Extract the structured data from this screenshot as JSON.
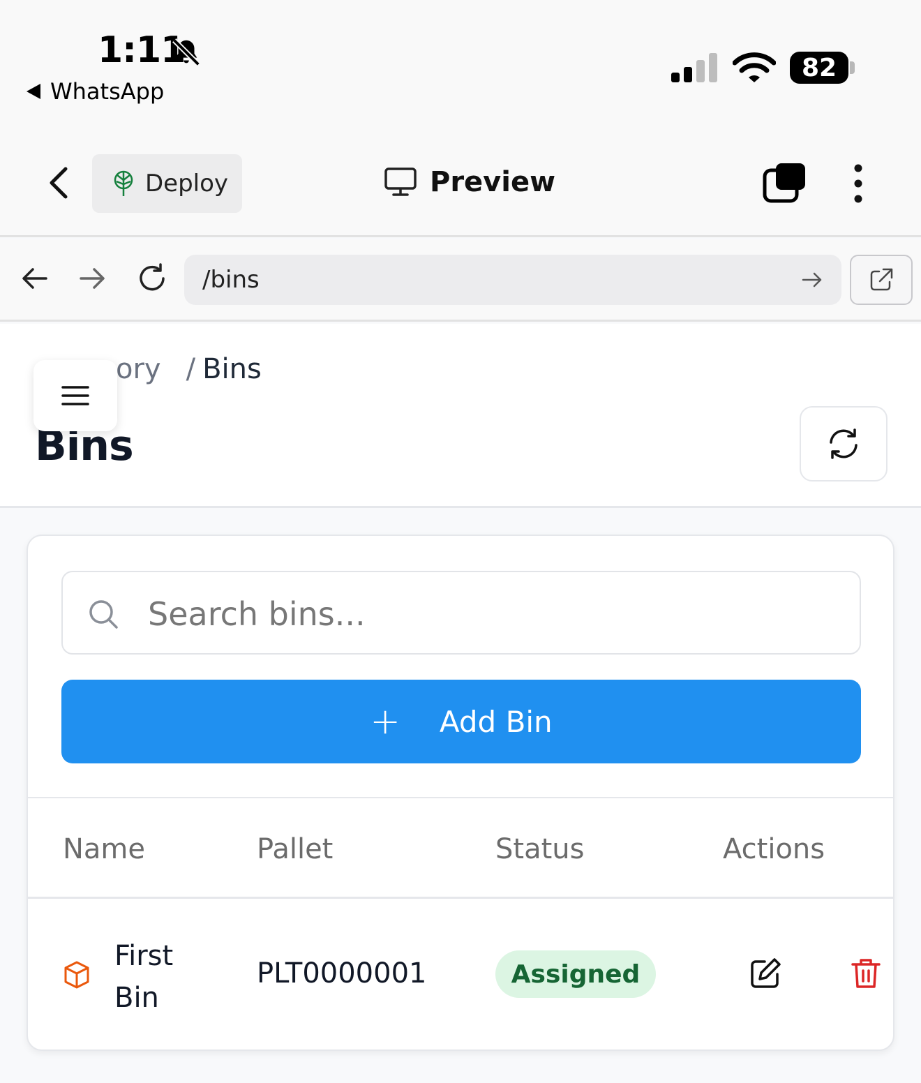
{
  "status_bar": {
    "time": "1:11",
    "back_app": "WhatsApp",
    "battery": "82",
    "icons": [
      "bell-slash-icon",
      "cellular-signal-icon",
      "wifi-icon",
      "battery-icon"
    ]
  },
  "app_toolbar": {
    "deploy_label": "Deploy",
    "preview_label": "Preview",
    "icons": [
      "chevron-left-icon",
      "tree-icon",
      "monitor-icon",
      "tabs-icon",
      "more-vertical-icon"
    ]
  },
  "browser": {
    "url": "/bins",
    "icons": [
      "arrow-left-icon",
      "arrow-right-icon",
      "refresh-icon",
      "go-arrow-icon",
      "external-link-icon"
    ]
  },
  "breadcrumb": {
    "parent": "ory",
    "separator": "/",
    "current": "Bins"
  },
  "page": {
    "title": "Bins"
  },
  "search": {
    "placeholder": "Search bins...",
    "value": ""
  },
  "add_button": {
    "label": "Add Bin",
    "icon": "plus-icon"
  },
  "table": {
    "headers": [
      "Name",
      "Pallet",
      "Status",
      "Actions"
    ],
    "rows": [
      {
        "name": "First Bin",
        "pallet": "PLT0000001",
        "status": "Assigned"
      }
    ]
  },
  "colors": {
    "primary": "#2090f0",
    "status_bg": "#dcf5e3",
    "status_text": "#166534",
    "danger": "#dc2626",
    "cube": "#ea580c",
    "deploy_icon": "#15803d"
  }
}
